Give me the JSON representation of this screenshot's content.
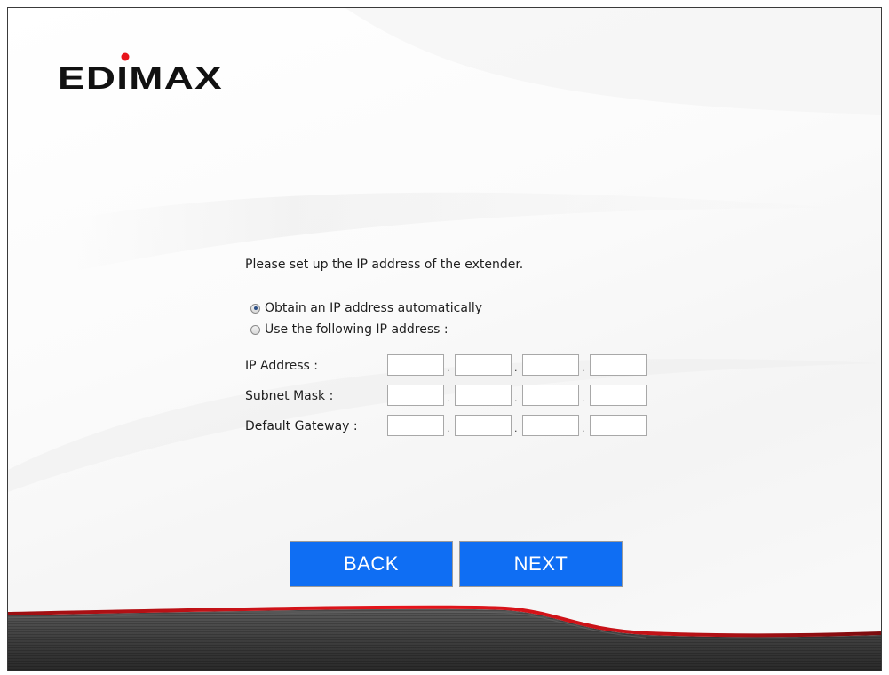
{
  "brand": {
    "logo_text": "EDIMAX",
    "accent_color": "#e8141b"
  },
  "setup": {
    "intro": "Please set up the IP address of the extender.",
    "options": [
      {
        "label": "Obtain an IP address automatically",
        "selected": true
      },
      {
        "label": "Use the following IP address :",
        "selected": false
      }
    ],
    "fields": [
      {
        "label": "IP Address :",
        "octets": [
          "",
          "",
          "",
          ""
        ]
      },
      {
        "label": "Subnet Mask :",
        "octets": [
          "",
          "",
          "",
          ""
        ]
      },
      {
        "label": "Default Gateway :",
        "octets": [
          "",
          "",
          "",
          ""
        ]
      }
    ],
    "separator": "."
  },
  "buttons": {
    "back": "BACK",
    "next": "NEXT",
    "color": "#0f6ef3"
  }
}
